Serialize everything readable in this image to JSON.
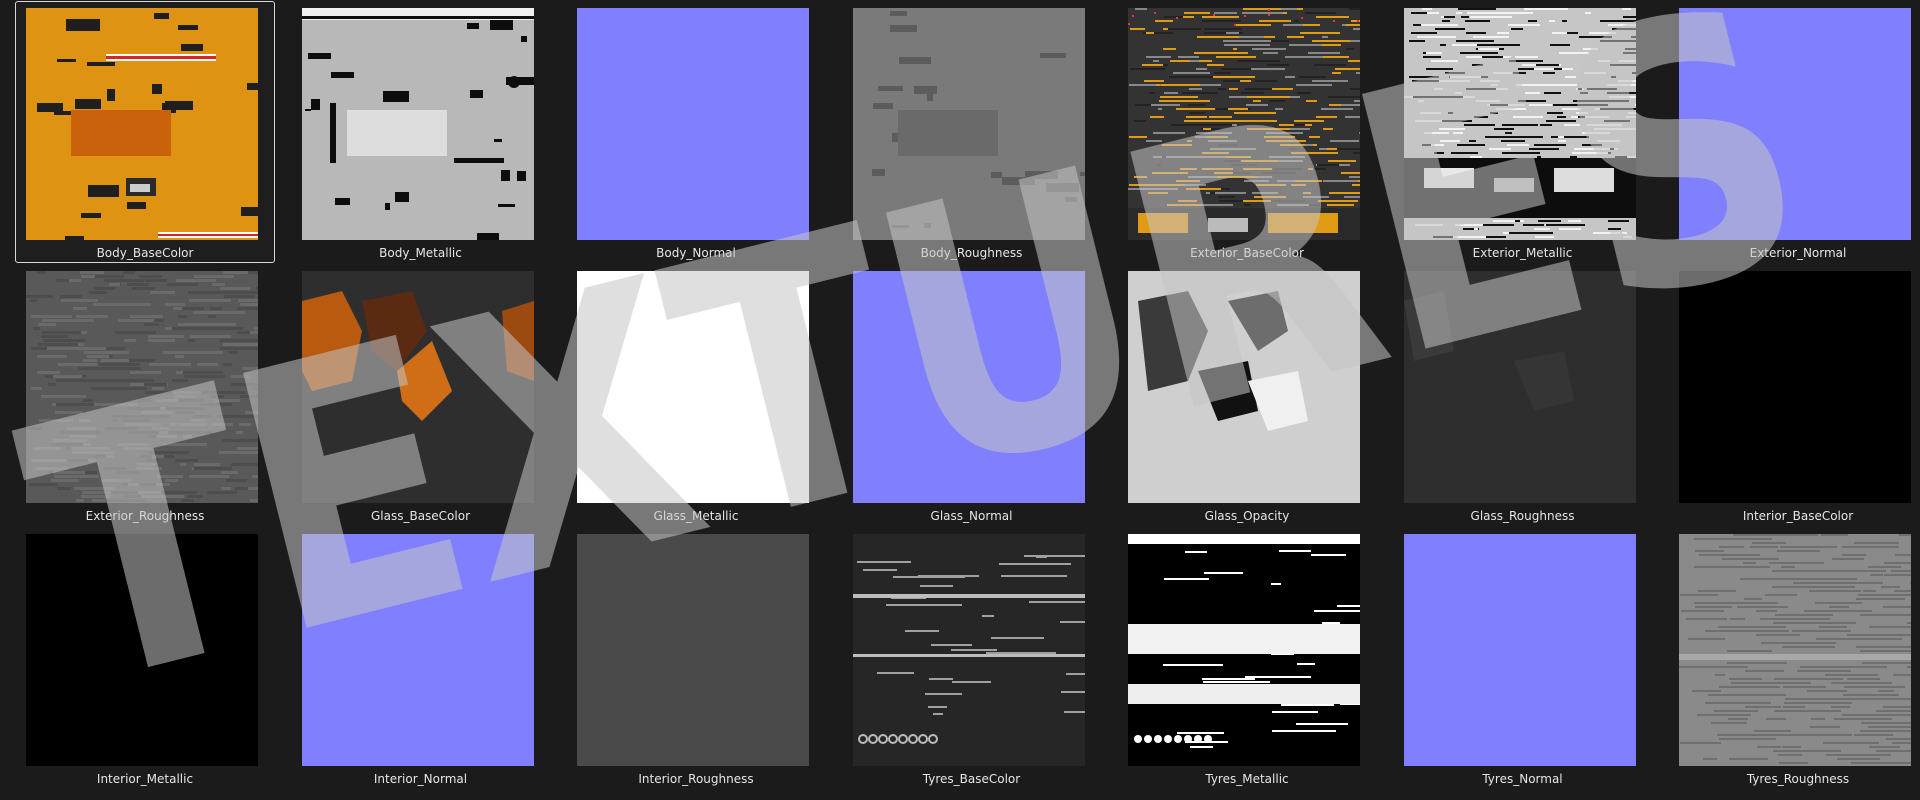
{
  "watermark": {
    "text": "TEXTURES",
    "color": "#c4c4c4"
  },
  "selected_index": 0,
  "textures": [
    {
      "name": "Body_BaseColor",
      "kind": "body-base",
      "base": "#de9412",
      "accent": "#c9620a"
    },
    {
      "name": "Body_Metallic",
      "kind": "body-metal",
      "base": "#b8b8b8",
      "accent": "#dddddd"
    },
    {
      "name": "Body_Normal",
      "kind": "flat",
      "base": "#8080ff"
    },
    {
      "name": "Body_Roughness",
      "kind": "body-rough",
      "base": "#7a7a7a",
      "accent": "#6a6a6a"
    },
    {
      "name": "Exterior_BaseColor",
      "kind": "ext-base",
      "base": "#333333",
      "accent": "#e09a14"
    },
    {
      "name": "Exterior_Metallic",
      "kind": "ext-metal",
      "base": "#c6c6c6",
      "accent": "#111111"
    },
    {
      "name": "Exterior_Normal",
      "kind": "flat",
      "base": "#8080ff"
    },
    {
      "name": "Exterior_Roughness",
      "kind": "noise",
      "base": "#595959",
      "accent": "#6a6a6a"
    },
    {
      "name": "Glass_BaseColor",
      "kind": "glass-base",
      "base": "#2e2e2e",
      "accent": "#b85a10"
    },
    {
      "name": "Glass_Metallic",
      "kind": "flat",
      "base": "#ffffff"
    },
    {
      "name": "Glass_Normal",
      "kind": "flat",
      "base": "#8080ff"
    },
    {
      "name": "Glass_Opacity",
      "kind": "glass-opacity",
      "base": "#cfcfcf",
      "accent": "#3a3a3a"
    },
    {
      "name": "Glass_Roughness",
      "kind": "glass-rough",
      "base": "#2e2e2e",
      "accent": "#3a3a3a"
    },
    {
      "name": "Interior_BaseColor",
      "kind": "flat",
      "base": "#000000"
    },
    {
      "name": "Interior_Metallic",
      "kind": "flat",
      "base": "#000000"
    },
    {
      "name": "Interior_Normal",
      "kind": "flat",
      "base": "#8080ff"
    },
    {
      "name": "Interior_Roughness",
      "kind": "flat",
      "base": "#4a4a4a"
    },
    {
      "name": "Tyres_BaseColor",
      "kind": "tyre-base",
      "base": "#262626",
      "accent": "#a0a0a0"
    },
    {
      "name": "Tyres_Metallic",
      "kind": "tyre-metal",
      "base": "#000000",
      "accent": "#ffffff"
    },
    {
      "name": "Tyres_Normal",
      "kind": "flat",
      "base": "#8080ff"
    },
    {
      "name": "Tyres_Roughness",
      "kind": "tyre-rough",
      "base": "#8a8a8a",
      "accent": "#6f6f6f"
    }
  ]
}
